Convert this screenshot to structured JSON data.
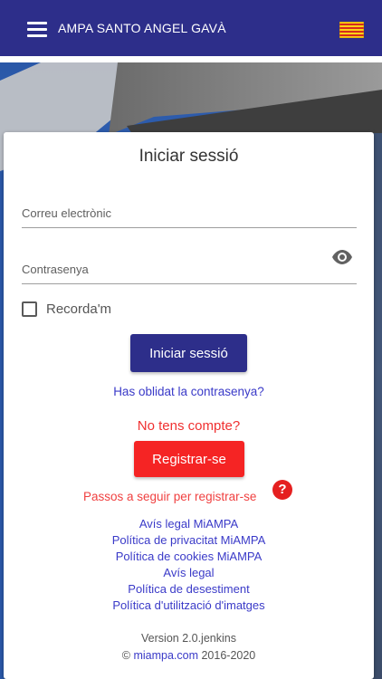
{
  "appbar": {
    "title": "AMPA SANTO ANGEL GAVÀ",
    "menu_icon": "hamburger-menu-icon",
    "flag_icon": "catalan-flag-icon",
    "background_color": "#2d2e8a"
  },
  "login": {
    "title": "Iniciar sessió",
    "email_placeholder": "Correu electrònic",
    "password_placeholder": "Contrasenya",
    "password_toggle_icon": "eye-icon",
    "remember_label": "Recorda'm",
    "submit_label": "Iniciar sessió",
    "forgot_link": "Has oblidat la contrasenya?"
  },
  "register": {
    "prompt": "No tens compte?",
    "button_label": "Registrar-se",
    "steps_link": "Passos a seguir per registrar-se",
    "help_icon": "question-mark-icon",
    "help_glyph": "?",
    "button_color": "#f52424"
  },
  "legal_links": [
    "Avís legal MiAMPA",
    "Política de privacitat MiAMPA",
    "Política de cookies MiAMPA",
    "Avís legal",
    "Política de desestiment",
    "Política d'utilització d'imatges"
  ],
  "footer": {
    "version": "Version 2.0.jenkins",
    "copyright_symbol": "©",
    "site_link": "miampa.com",
    "years": "2016-2020"
  },
  "colors": {
    "primary": "#2d2e8a",
    "danger": "#f52424",
    "link": "#3a3ac8"
  }
}
